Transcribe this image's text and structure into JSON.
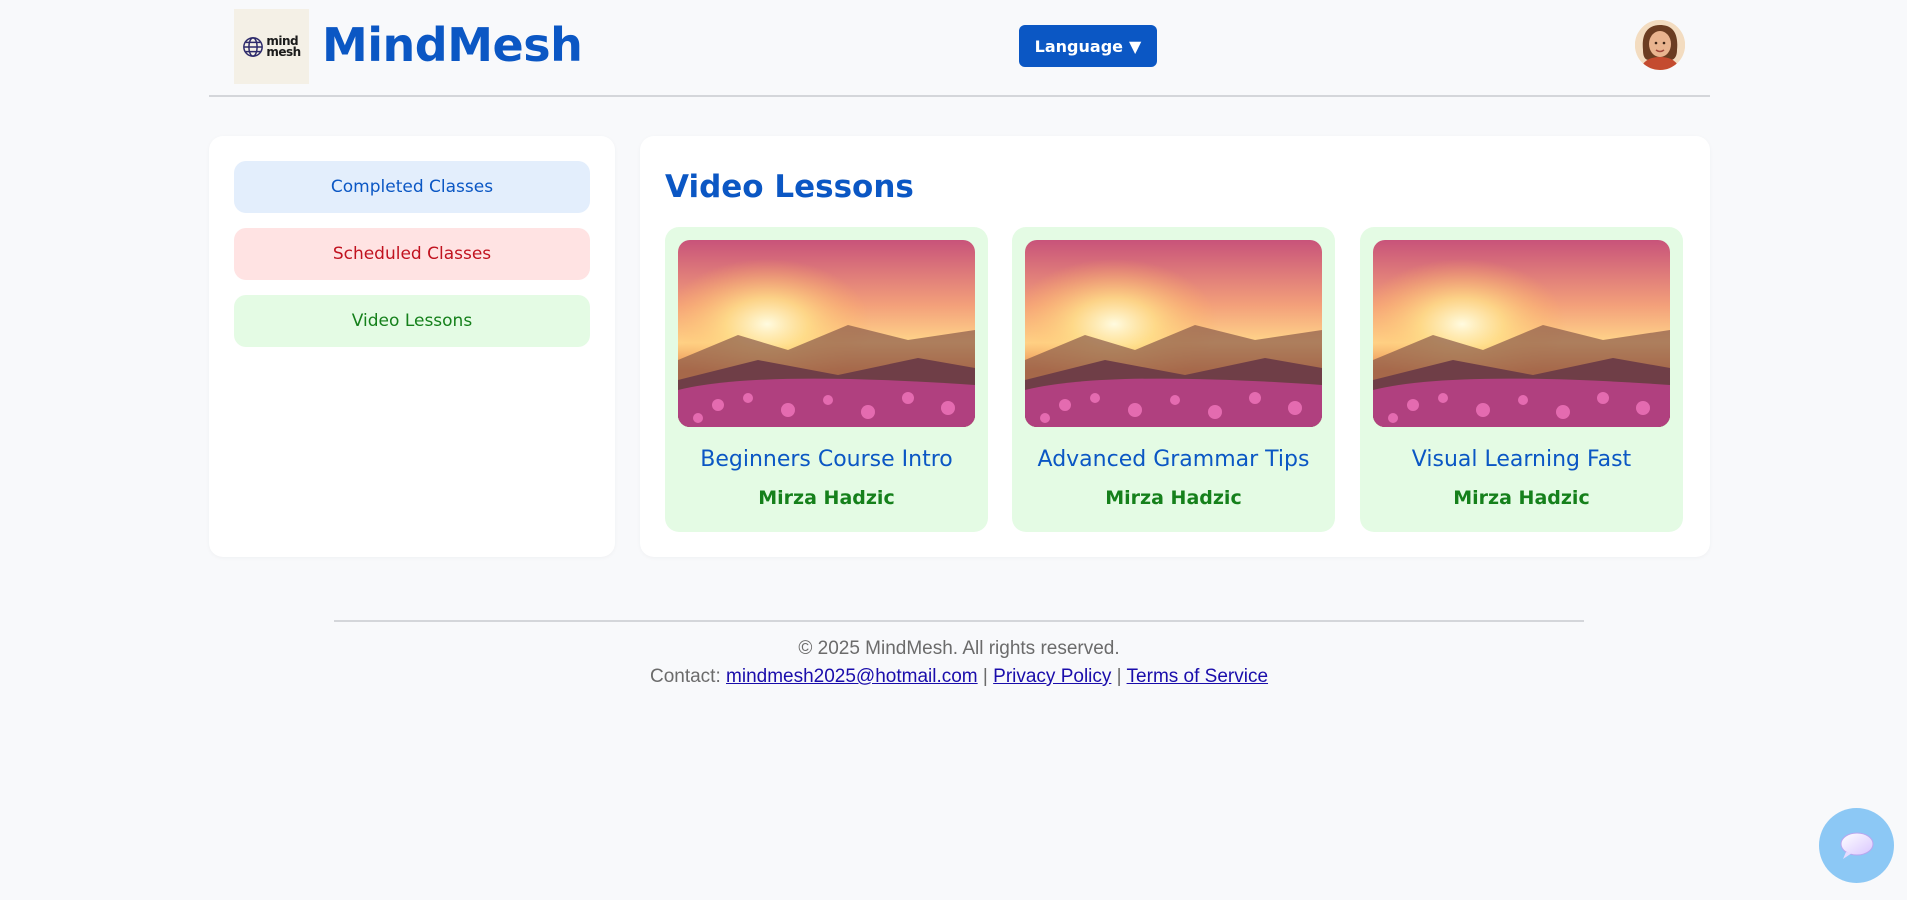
{
  "header": {
    "logo_text_1": "mind",
    "logo_text_2": "mesh",
    "brand": "MindMesh",
    "language_label": "Language",
    "language_arrow": "▼"
  },
  "sidebar": {
    "items": [
      {
        "label": "Completed Classes"
      },
      {
        "label": "Scheduled Classes"
      },
      {
        "label": "Video Lessons"
      }
    ]
  },
  "main": {
    "title": "Video Lessons",
    "cards": [
      {
        "title": "Beginners Course Intro",
        "author": "Mirza Hadzic"
      },
      {
        "title": "Advanced Grammar Tips",
        "author": "Mirza Hadzic"
      },
      {
        "title": "Visual Learning Fast",
        "author": "Mirza Hadzic"
      }
    ]
  },
  "footer": {
    "copyright": "© 2025 MindMesh. All rights reserved.",
    "contact_prefix": "Contact:",
    "email": "mindmesh2025@hotmail.com",
    "sep": "|",
    "privacy": "Privacy Policy",
    "terms": "Terms of Service"
  },
  "colors": {
    "brand_blue": "#0b57c4",
    "success_green": "#15801b",
    "danger_red": "#c1121f"
  },
  "icons": {
    "logo": "globe-icon",
    "avatar": "user-avatar",
    "chat": "chat-bubble-icon"
  }
}
